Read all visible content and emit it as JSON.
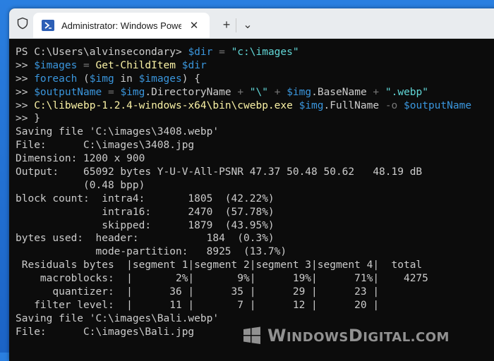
{
  "window": {
    "tab_title": "Administrator: Windows PowerShell",
    "new_tab_label": "+",
    "dropdown_label": "⌄",
    "close_label": "✕"
  },
  "terminal": {
    "lines": [
      {
        "segs": [
          {
            "t": "PS C:\\Users\\alvinsecondary> ",
            "c": "prompt"
          },
          {
            "t": "$dir",
            "c": "var"
          },
          {
            "t": " = ",
            "c": "op"
          },
          {
            "t": "\"c:\\images\"",
            "c": "str"
          }
        ]
      },
      {
        "segs": [
          {
            "t": ">> ",
            "c": "prompt"
          },
          {
            "t": "$images",
            "c": "var"
          },
          {
            "t": " = ",
            "c": "op"
          },
          {
            "t": "Get-ChildItem",
            "c": "cmd"
          },
          {
            "t": " ",
            "c": "prop"
          },
          {
            "t": "$dir",
            "c": "var"
          }
        ]
      },
      {
        "segs": [
          {
            "t": ">> ",
            "c": "prompt"
          },
          {
            "t": "foreach",
            "c": "var"
          },
          {
            "t": " (",
            "c": "prop"
          },
          {
            "t": "$img",
            "c": "var"
          },
          {
            "t": " in ",
            "c": "prop"
          },
          {
            "t": "$images",
            "c": "var"
          },
          {
            "t": ") {",
            "c": "prop"
          }
        ]
      },
      {
        "segs": [
          {
            "t": ">> ",
            "c": "prompt"
          },
          {
            "t": "$outputName",
            "c": "var"
          },
          {
            "t": " = ",
            "c": "op"
          },
          {
            "t": "$img",
            "c": "var"
          },
          {
            "t": ".DirectoryName ",
            "c": "prop"
          },
          {
            "t": "+ ",
            "c": "op"
          },
          {
            "t": "\"\\\"",
            "c": "str"
          },
          {
            "t": " + ",
            "c": "op"
          },
          {
            "t": "$img",
            "c": "var"
          },
          {
            "t": ".BaseName ",
            "c": "prop"
          },
          {
            "t": "+ ",
            "c": "op"
          },
          {
            "t": "\".webp\"",
            "c": "str"
          }
        ]
      },
      {
        "segs": [
          {
            "t": ">> ",
            "c": "prompt"
          },
          {
            "t": "C:\\libwebp-1.2.4-windows-x64\\bin\\cwebp.exe",
            "c": "cmd"
          },
          {
            "t": " ",
            "c": "prop"
          },
          {
            "t": "$img",
            "c": "var"
          },
          {
            "t": ".FullName ",
            "c": "prop"
          },
          {
            "t": "-o ",
            "c": "op"
          },
          {
            "t": "$outputName",
            "c": "var"
          }
        ]
      },
      {
        "segs": [
          {
            "t": ">> }",
            "c": "prompt"
          }
        ]
      },
      {
        "segs": [
          {
            "t": "Saving file 'C:\\images\\3408.webp'",
            "c": "prop"
          }
        ]
      },
      {
        "segs": [
          {
            "t": "File:      C:\\images\\3408.jpg",
            "c": "prop"
          }
        ]
      },
      {
        "segs": [
          {
            "t": "Dimension: 1200 x 900",
            "c": "prop"
          }
        ]
      },
      {
        "segs": [
          {
            "t": "Output:    65092 bytes Y-U-V-All-PSNR 47.37 50.48 50.62   48.19 dB",
            "c": "prop"
          }
        ]
      },
      {
        "segs": [
          {
            "t": "           (0.48 bpp)",
            "c": "prop"
          }
        ]
      },
      {
        "segs": [
          {
            "t": "block count:  intra4:       1805  (42.22%)",
            "c": "prop"
          }
        ]
      },
      {
        "segs": [
          {
            "t": "              intra16:      2470  (57.78%)",
            "c": "prop"
          }
        ]
      },
      {
        "segs": [
          {
            "t": "              skipped:      1879  (43.95%)",
            "c": "prop"
          }
        ]
      },
      {
        "segs": [
          {
            "t": "bytes used:  header:           184  (0.3%)",
            "c": "prop"
          }
        ]
      },
      {
        "segs": [
          {
            "t": "             mode-partition:   8925  (13.7%)",
            "c": "prop"
          }
        ]
      },
      {
        "segs": [
          {
            "t": " Residuals bytes  |segment 1|segment 2|segment 3|segment 4|  total",
            "c": "prop"
          }
        ]
      },
      {
        "segs": [
          {
            "t": "    macroblocks:  |       2%|       9%|      19%|      71%|    4275",
            "c": "prop"
          }
        ]
      },
      {
        "segs": [
          {
            "t": "      quantizer:  |      36 |      35 |      29 |      23 |",
            "c": "prop"
          }
        ]
      },
      {
        "segs": [
          {
            "t": "   filter level:  |      11 |       7 |      12 |      20 |",
            "c": "prop"
          }
        ]
      },
      {
        "segs": [
          {
            "t": "Saving file 'C:\\images\\Bali.webp'",
            "c": "prop"
          }
        ]
      },
      {
        "segs": [
          {
            "t": "File:      C:\\images\\Bali.jpg",
            "c": "prop"
          }
        ]
      }
    ]
  },
  "watermark": {
    "text_big": "W",
    "text_rest": "INDOWS",
    "text_big2": "D",
    "text_rest2": "IGITAL.COM"
  },
  "colors": {
    "background": "#0c0c0c",
    "text": "#cccccc",
    "variable": "#3a96dd",
    "string": "#61d6d6",
    "command": "#f9f1a5",
    "operator": "#767676"
  }
}
